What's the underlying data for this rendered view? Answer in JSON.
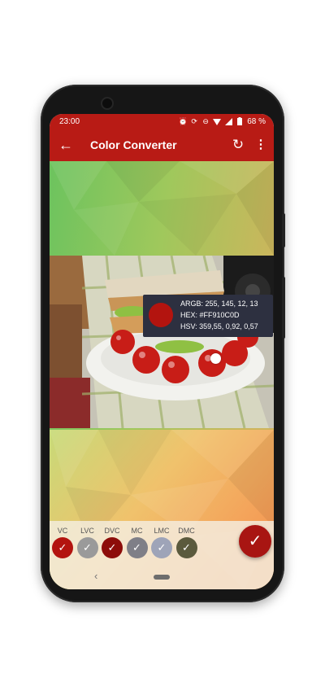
{
  "status_bar": {
    "time": "23:00",
    "icons": [
      "alarm-icon",
      "sync-icon",
      "minus-circle-icon",
      "wifi-icon",
      "signal-icon",
      "battery-icon"
    ],
    "battery": "68 %"
  },
  "app_bar": {
    "title": "Color Converter",
    "back_icon": "back-arrow-icon",
    "refresh_icon": "refresh-icon",
    "more_icon": "more-vert-icon"
  },
  "color_info": {
    "argb": "ARGB: 255, 145, 12, 13",
    "hex": "HEX: #FF910C0D",
    "hsv": "HSV: 359,55, 0,92, 0,57",
    "swatch_color": "#b3140f"
  },
  "color_variants": [
    {
      "label": "VC",
      "color": "#b3140f",
      "check": "✓"
    },
    {
      "label": "LVC",
      "color": "#9a9a9a",
      "check": "✓"
    },
    {
      "label": "DVC",
      "color": "#8d0d0a",
      "check": "✓"
    },
    {
      "label": "MC",
      "color": "#7f7f87",
      "check": "✓"
    },
    {
      "label": "LMC",
      "color": "#9ea4b8",
      "check": "✓"
    },
    {
      "label": "DMC",
      "color": "#5b5a3d",
      "check": "✓"
    }
  ],
  "confirm": {
    "icon": "check-icon",
    "glyph": "✓"
  },
  "nav": {
    "back_glyph": "‹"
  },
  "theme": {
    "primary": "#b81b15",
    "accent": "#a81512"
  }
}
